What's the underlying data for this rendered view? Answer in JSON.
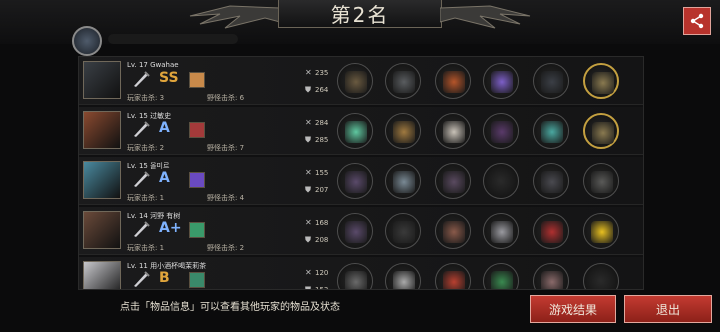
{
  "header": {
    "title": "第2名",
    "share_icon": "share-icon"
  },
  "colors": {
    "accent": "#b8332c",
    "gold": "#c4a040",
    "panel": "#141415"
  },
  "players": [
    {
      "level_name": "Lv. 17  Gwahae",
      "grade": "SS",
      "player_kills": "玩家击杀: 3",
      "monster_kills": "野怪击杀: 6",
      "attack": "235",
      "defense": "264",
      "avatar_color": "#3a3f45",
      "skill_color": "#c98a4a",
      "items": [
        "#6a5a40",
        "#5a5d60",
        "#b5552a",
        "#7d5fc8",
        "#3b3f46",
        "#8a7a50"
      ]
    },
    {
      "level_name": "Lv. 15  过敏史",
      "grade": "A",
      "player_kills": "玩家击杀: 2",
      "monster_kills": "野怪击杀: 7",
      "attack": "284",
      "defense": "285",
      "avatar_color": "#8a4a30",
      "skill_color": "#a33a3a",
      "items": [
        "#5fc8a0",
        "#a07a40",
        "#c9c2b8",
        "#5a3a6a",
        "#4aa8a0",
        "#8a7a50"
      ]
    },
    {
      "level_name": "Lv. 15  올미르",
      "grade": "A",
      "player_kills": "玩家击杀: 1",
      "monster_kills": "野怪击杀: 4",
      "attack": "155",
      "defense": "207",
      "avatar_color": "#4a8aa0",
      "skill_color": "#6a4ac0",
      "items": [
        "#5a4a6a",
        "#7a8a95",
        "#5a4a60",
        "",
        "#4a4a50",
        "#5a5a58"
      ]
    },
    {
      "level_name": "Lv. 14  河野 有树",
      "grade": "A+",
      "player_kills": "玩家击杀: 1",
      "monster_kills": "野怪击杀: 2",
      "attack": "168",
      "defense": "208",
      "avatar_color": "#6a4a3a",
      "skill_color": "#3a9a6a",
      "items": [
        "#5a4a6a",
        "#3a3a3a",
        "#8a5a4a",
        "#9a9aa0",
        "#b03030",
        "#e8c020"
      ]
    },
    {
      "level_name": "Lv. 11  用小酒杯喝茉莉茶",
      "grade": "B",
      "player_kills": "玩家击杀: 0",
      "monster_kills": "野怪击杀: 0",
      "attack": "120",
      "defense": "153",
      "avatar_color": "#c8c8cc",
      "skill_color": "#3a8a6a",
      "items": [
        "#6a6a6a",
        "#aaaaaa",
        "#b84030",
        "#3a8a50",
        "#8a6a6a",
        ""
      ]
    }
  ],
  "footer": {
    "hint": "点击「物品信息」可以查看其他玩家的物品及状态",
    "results_button": "游戏结果",
    "exit_button": "退出"
  }
}
